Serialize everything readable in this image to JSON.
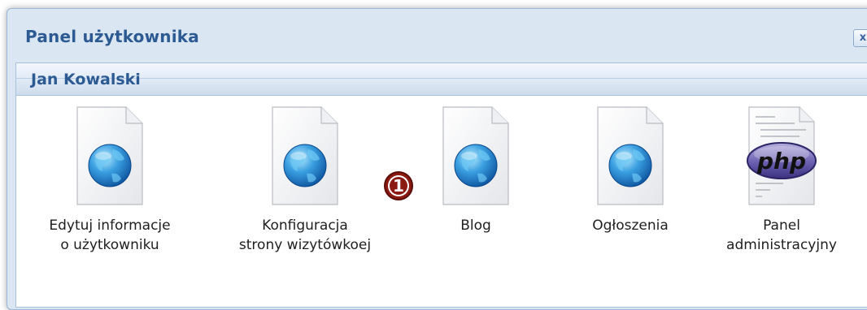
{
  "dialog": {
    "title": "Panel użytkownika",
    "close_label": "x"
  },
  "panel": {
    "user_name": "Jan Kowalski"
  },
  "items": [
    {
      "label": "Edytuj informacje\no użytkowniku",
      "icon": "web-document-icon"
    },
    {
      "label": "Konfiguracja\nstrony wizytówkoej",
      "icon": "web-document-icon"
    },
    {
      "label": "Blog",
      "icon": "web-document-icon"
    },
    {
      "label": "Ogłoszenia",
      "icon": "web-document-icon"
    },
    {
      "label": "Panel\nadministracyjny",
      "icon": "php-document-icon"
    }
  ],
  "marker": {
    "number": "1"
  },
  "colors": {
    "title": "#2c5a92",
    "marker": "#8b1a12"
  }
}
